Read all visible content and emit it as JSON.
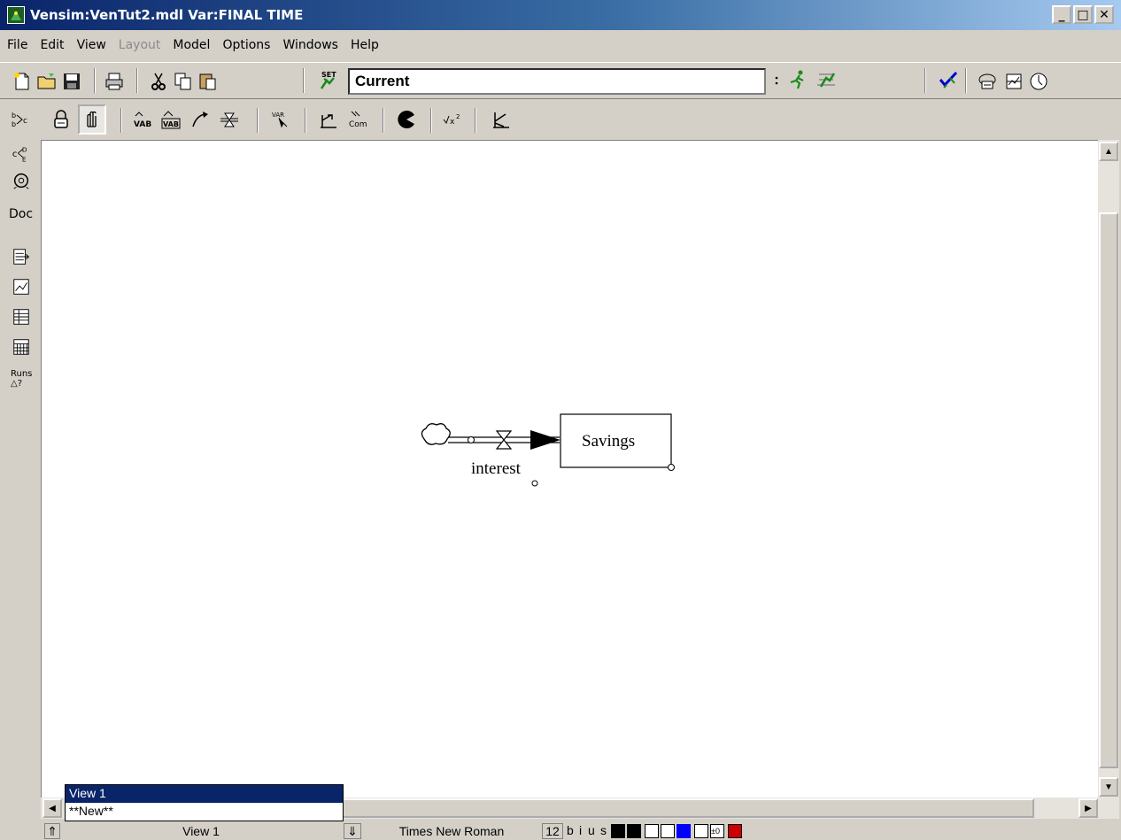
{
  "window": {
    "title": "Vensim:VenTut2.mdl Var:FINAL TIME",
    "buttons": [
      "_",
      "□",
      "✕"
    ]
  },
  "menu": [
    {
      "label": "File",
      "enabled": true
    },
    {
      "label": "Edit",
      "enabled": true
    },
    {
      "label": "View",
      "enabled": true
    },
    {
      "label": "Layout",
      "enabled": false
    },
    {
      "label": "Model",
      "enabled": true
    },
    {
      "label": "Options",
      "enabled": true
    },
    {
      "label": "Windows",
      "enabled": true
    },
    {
      "label": "Help",
      "enabled": true
    }
  ],
  "toolbar": {
    "run_name": "Current",
    "set_label": "SET"
  },
  "lefttools": {
    "doc_label": "Doc",
    "runs_label": "Runs"
  },
  "diagram": {
    "stock_label": "Savings",
    "flow_label": "interest"
  },
  "view_popup": {
    "options": [
      "View 1",
      "**New**"
    ],
    "selected": "View 1"
  },
  "statusbar": {
    "view_name": "View 1",
    "font_name": "Times New Roman",
    "font_size": "12",
    "toggles": [
      "b",
      "i",
      "u",
      "s"
    ],
    "colors": {
      "text": "#000000",
      "fill": "#000000",
      "accent": "#0000ff",
      "red": "#cc0000"
    }
  }
}
